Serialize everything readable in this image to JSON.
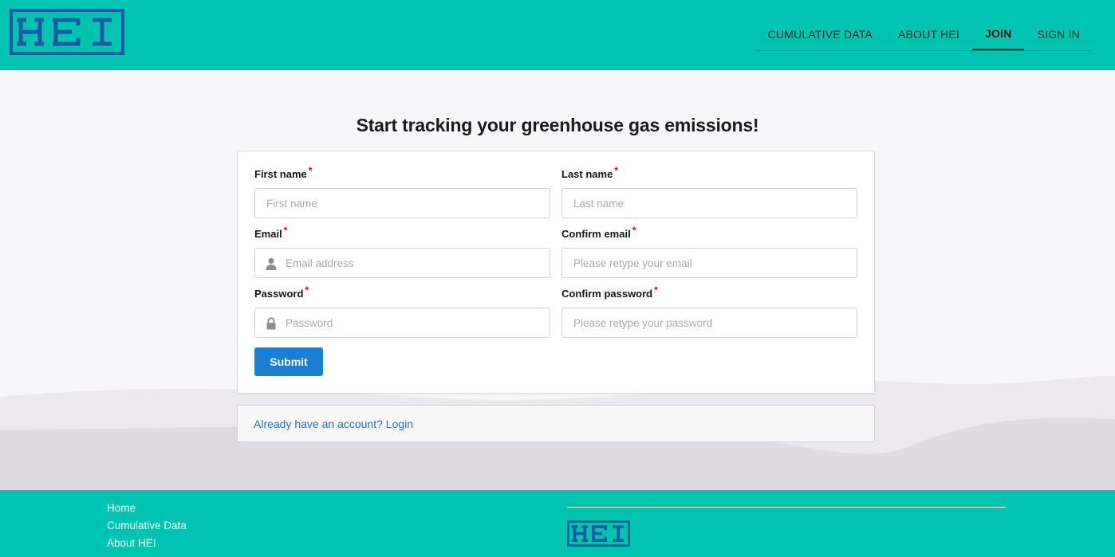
{
  "brand": {
    "logo_text": "HEI",
    "color": "#1a5aa3"
  },
  "nav": {
    "items": [
      {
        "label": "CUMULATIVE DATA"
      },
      {
        "label": "ABOUT HEI"
      },
      {
        "label": "JOIN",
        "active": true
      },
      {
        "label": "SIGN IN"
      }
    ]
  },
  "form": {
    "title": "Start tracking your greenhouse gas emissions!",
    "first_name": {
      "label": "First name",
      "placeholder": "First name",
      "required_mark": "*"
    },
    "last_name": {
      "label": "Last name",
      "placeholder": "Last name",
      "required_mark": "*"
    },
    "email": {
      "label": "Email",
      "placeholder": "Email address",
      "required_mark": "*",
      "icon": "user-icon"
    },
    "confirm_email": {
      "label": "Confirm email",
      "placeholder": "Please retype your email",
      "required_mark": "*"
    },
    "password": {
      "label": "Password",
      "placeholder": "Password",
      "required_mark": "*",
      "icon": "lock-icon"
    },
    "confirm_password": {
      "label": "Confirm password",
      "placeholder": "Please retype your password",
      "required_mark": "*"
    },
    "submit_label": "Submit"
  },
  "login_prompt": "Already have an account? Login",
  "footer": {
    "links": [
      "Home",
      "Cumulative Data",
      "About HEI"
    ]
  },
  "colors": {
    "header": "#00c3b0",
    "button": "#1a7fd4",
    "required": "#dd0000"
  }
}
